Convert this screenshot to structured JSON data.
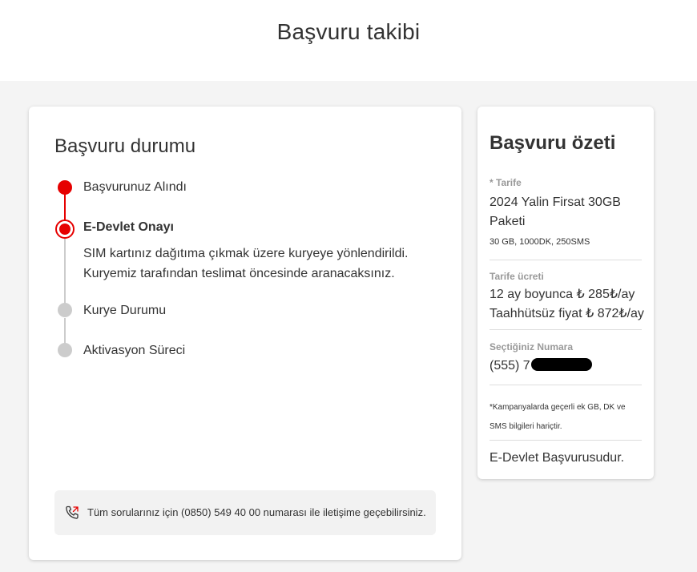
{
  "header": {
    "title": "Başvuru takibi"
  },
  "status": {
    "title": "Başvuru durumu",
    "steps": [
      {
        "label": "Başvurunuz Alındı",
        "state": "done"
      },
      {
        "label": "E-Devlet Onayı",
        "state": "active",
        "description_line1": "SIM kartınız dağıtıma çıkmak üzere kuryeye yönlendirildi.",
        "description_line2": "Kuryemiz tarafından teslimat öncesinde aranacaksınız."
      },
      {
        "label": "Kurye Durumu",
        "state": "pending"
      },
      {
        "label": "Aktivasyon Süreci",
        "state": "pending"
      }
    ],
    "info": {
      "icon": "phone-call-icon",
      "text": "Tüm sorularınız için (0850) 549 40 00 numarası ile iletişime geçebilirsiniz."
    }
  },
  "summary": {
    "title": "Başvuru özeti",
    "tariff_label": "* Tarife",
    "tariff_name_line1": "2024 Yalin Firsat 30GB",
    "tariff_name_line2": "Paketi",
    "tariff_details": "30 GB, 1000DK, 250SMS",
    "fee_label": "Tarife ücreti",
    "fee_line1": "12 ay boyunca ₺ 285₺/ay",
    "fee_line2": "Taahhütsüz fiyat ₺ 872₺/ay",
    "number_label": "Seçtiğiniz Numara",
    "number_prefix": "(555) 7",
    "footnote_line1": "*Kampanyalarda geçerli ek GB, DK ve",
    "footnote_line2": "SMS bilgileri hariçtir.",
    "application_type": "E-Devlet Başvurusudur."
  },
  "colors": {
    "accent": "#e60000",
    "pending": "#cccccc",
    "background": "#f4f4f4"
  }
}
